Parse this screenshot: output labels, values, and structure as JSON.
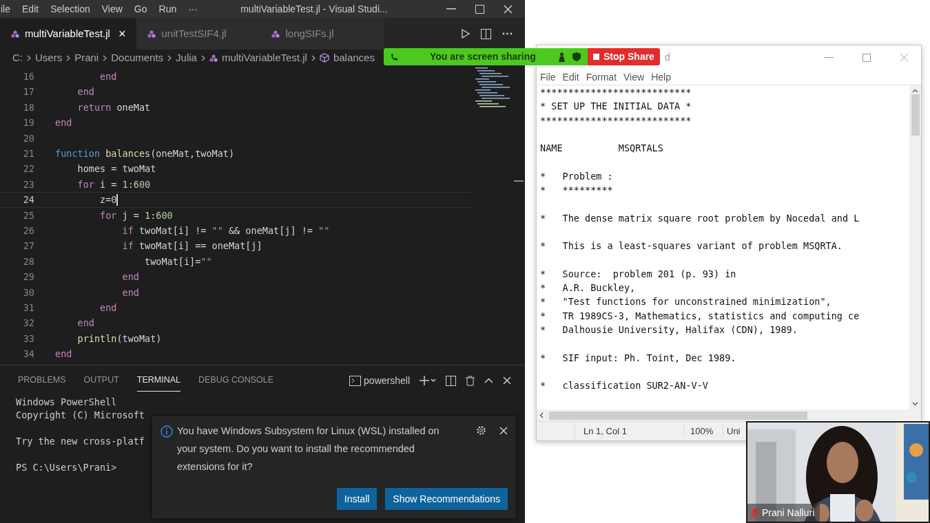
{
  "vscode": {
    "menu": [
      "ile",
      "Edit",
      "Selection",
      "View",
      "Go",
      "Run",
      "···"
    ],
    "title": "multiVariableTest.jl - Visual Studi...",
    "tabs": [
      {
        "label": "multiVariableTest.jl",
        "selected": true,
        "close": "×"
      },
      {
        "label": "unitTestSIF4.jl",
        "selected": false
      },
      {
        "label": "longSIFs.jl",
        "selected": false
      }
    ],
    "breadcrumbs": [
      {
        "kind": "text",
        "label": "C:"
      },
      {
        "kind": "text",
        "label": "Users"
      },
      {
        "kind": "text",
        "label": "Prani"
      },
      {
        "kind": "text",
        "label": "Documents"
      },
      {
        "kind": "text",
        "label": "Julia"
      },
      {
        "kind": "file",
        "label": "multiVariableTest.jl"
      },
      {
        "kind": "symbol",
        "label": "balances"
      }
    ],
    "code": [
      {
        "number": "16",
        "current": false,
        "segments": [
          {
            "kind": "kw",
            "text": "        end"
          }
        ]
      },
      {
        "number": "17",
        "current": false,
        "segments": [
          {
            "kind": "kw",
            "text": "    end"
          }
        ]
      },
      {
        "number": "18",
        "current": false,
        "segments": [
          {
            "kind": "kw",
            "text": "    return"
          },
          {
            "kind": "plain",
            "text": " oneMat"
          }
        ]
      },
      {
        "number": "19",
        "current": false,
        "segments": [
          {
            "kind": "kw",
            "text": "end"
          }
        ]
      },
      {
        "number": "20",
        "current": false
      },
      {
        "number": "21",
        "current": false,
        "segments": [
          {
            "kind": "def",
            "text": "function"
          },
          {
            "kind": "fn",
            "text": " balances"
          },
          {
            "kind": "plain",
            "text": "(oneMat,twoMat)"
          }
        ]
      },
      {
        "number": "22",
        "current": false,
        "segments": [
          {
            "kind": "plain",
            "text": "    homes = twoMat"
          }
        ]
      },
      {
        "number": "23",
        "current": false,
        "segments": [
          {
            "kind": "kw",
            "text": "    for"
          },
          {
            "kind": "plain",
            "text": " i = "
          },
          {
            "kind": "num",
            "text": "1"
          },
          {
            "kind": "plain",
            "text": ":"
          },
          {
            "kind": "num",
            "text": "600"
          }
        ]
      },
      {
        "number": "24",
        "current": true,
        "segments": [
          {
            "kind": "plain",
            "text": "        z="
          },
          {
            "kind": "num",
            "text": "0"
          }
        ]
      },
      {
        "number": "25",
        "current": false,
        "segments": [
          {
            "kind": "kw",
            "text": "        for"
          },
          {
            "kind": "plain",
            "text": " j = "
          },
          {
            "kind": "num",
            "text": "1"
          },
          {
            "kind": "plain",
            "text": ":"
          },
          {
            "kind": "num",
            "text": "600"
          }
        ]
      },
      {
        "number": "26",
        "current": false,
        "segments": [
          {
            "kind": "kw",
            "text": "            if"
          },
          {
            "kind": "plain",
            "text": " twoMat[i] != "
          },
          {
            "kind": "str",
            "text": "\"\""
          },
          {
            "kind": "plain",
            "text": " && oneMat[j] != "
          },
          {
            "kind": "str",
            "text": "\"\""
          }
        ]
      },
      {
        "number": "27",
        "current": false,
        "segments": [
          {
            "kind": "kw",
            "text": "            if"
          },
          {
            "kind": "plain",
            "text": " twoMat[i] == oneMat[j]"
          }
        ]
      },
      {
        "number": "28",
        "current": false,
        "segments": [
          {
            "kind": "plain",
            "text": "                twoMat[i]="
          },
          {
            "kind": "str",
            "text": "\"\""
          }
        ]
      },
      {
        "number": "29",
        "current": false,
        "segments": [
          {
            "kind": "kw",
            "text": "            end"
          }
        ]
      },
      {
        "number": "30",
        "current": false,
        "segments": [
          {
            "kind": "kw",
            "text": "            end"
          }
        ]
      },
      {
        "number": "31",
        "current": false,
        "segments": [
          {
            "kind": "kw",
            "text": "        end"
          }
        ]
      },
      {
        "number": "32",
        "current": false,
        "segments": [
          {
            "kind": "kw",
            "text": "    end"
          }
        ]
      },
      {
        "number": "33",
        "current": false,
        "segments": [
          {
            "kind": "fn",
            "text": "    println"
          },
          {
            "kind": "plain",
            "text": "(twoMat)"
          }
        ]
      },
      {
        "number": "34",
        "current": false,
        "segments": [
          {
            "kind": "kw",
            "text": "end"
          }
        ]
      }
    ],
    "panel_tabs": [
      {
        "label": "PROBLEMS",
        "selected": false
      },
      {
        "label": "OUTPUT",
        "selected": false
      },
      {
        "label": "TERMINAL",
        "selected": true
      },
      {
        "label": "DEBUG CONSOLE",
        "selected": false
      }
    ],
    "terminal_name": "powershell",
    "terminal": [
      {
        "kind": "text",
        "text": "Windows PowerShell"
      },
      {
        "kind": "text",
        "text": "Copyright (C) Microsoft"
      },
      {
        "kind": "blank"
      },
      {
        "kind": "text",
        "text": "Try the new cross-platf"
      },
      {
        "kind": "blank"
      },
      {
        "kind": "text",
        "text": "PS C:\\Users\\Prani>"
      }
    ],
    "notification": {
      "message": "You have Windows Subsystem for Linux (WSL) installed on your system. Do you want to install the recommended extensions for it?",
      "buttons": [
        "Install",
        "Show Recommendations"
      ]
    }
  },
  "share_bar": {
    "label": "You are screen sharing",
    "stop": "Stop Share"
  },
  "notepad": {
    "title": "d",
    "menu": [
      "File",
      "Edit",
      "Format",
      "View",
      "Help"
    ],
    "lines": [
      {
        "kind": "text",
        "text": "***************************"
      },
      {
        "kind": "text",
        "text": "* SET UP THE INITIAL DATA *"
      },
      {
        "kind": "text",
        "text": "***************************"
      },
      {
        "kind": "blank"
      },
      {
        "kind": "text",
        "text": "NAME          MSQRTALS"
      },
      {
        "kind": "blank"
      },
      {
        "kind": "text",
        "text": "*   Problem :"
      },
      {
        "kind": "text",
        "text": "*   *********"
      },
      {
        "kind": "blank"
      },
      {
        "kind": "text",
        "text": "*   The dense matrix square root problem by Nocedal and L"
      },
      {
        "kind": "blank"
      },
      {
        "kind": "text",
        "text": "*   This is a least-squares variant of problem MSQRTA."
      },
      {
        "kind": "blank"
      },
      {
        "kind": "text",
        "text": "*   Source:  problem 201 (p. 93) in"
      },
      {
        "kind": "text",
        "text": "*   A.R. Buckley,"
      },
      {
        "kind": "text",
        "text": "*   \"Test functions for unconstrained minimization\","
      },
      {
        "kind": "text",
        "text": "*   TR 1989CS-3, Mathematics, statistics and computing ce"
      },
      {
        "kind": "text",
        "text": "*   Dalhousie University, Halifax (CDN), 1989."
      },
      {
        "kind": "blank"
      },
      {
        "kind": "text",
        "text": "*   SIF input: Ph. Toint, Dec 1989."
      },
      {
        "kind": "blank"
      },
      {
        "kind": "text",
        "text": "*   classification SUR2-AN-V-V"
      }
    ],
    "status": [
      "Ln 1, Col 1",
      "100%",
      "Uni"
    ]
  },
  "video": {
    "name": "Prani Nalluri",
    "muted": true
  }
}
